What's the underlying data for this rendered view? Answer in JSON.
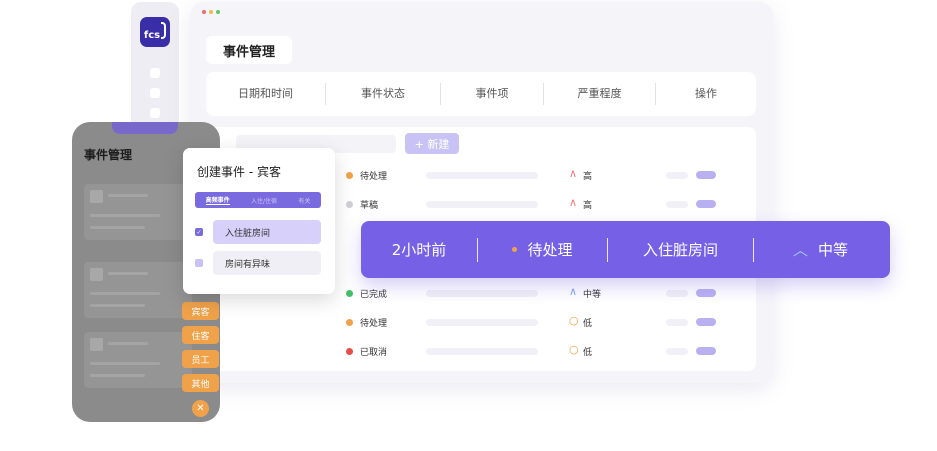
{
  "sidebar": {
    "logo_text": "fcs",
    "dots": 3
  },
  "main": {
    "title": "事件管理",
    "columns": [
      "日期和时间",
      "事件状态",
      "事件项",
      "严重程度",
      "操作"
    ],
    "new_button": "+ 新建",
    "rows": [
      {
        "status": "待处理",
        "status_color": "#f0a24a",
        "severity_icon": "^",
        "severity_icon_color": "#f27a7a",
        "severity": "高"
      },
      {
        "status": "草稿",
        "status_color": "#cfcfd6",
        "severity_icon": "^",
        "severity_icon_color": "#f27a7a",
        "severity": "高"
      },
      {
        "status": "已完成",
        "status_color": "#44c06b",
        "severity_icon": "^",
        "severity_icon_color": "#7aa8f2",
        "severity": "中等"
      },
      {
        "status": "待处理",
        "status_color": "#f0a24a",
        "severity_icon": "O",
        "severity_icon_color": "#f0a24a",
        "severity": "低"
      },
      {
        "status": "已取消",
        "status_color": "#ea4b4b",
        "severity_icon": "O",
        "severity_icon_color": "#f0a24a",
        "severity": "低"
      }
    ]
  },
  "phone": {
    "title": "事件管理",
    "categories": [
      "宾客",
      "住客",
      "员工",
      "其他"
    ],
    "close_icon": "x"
  },
  "modal": {
    "title": "创建事件 - 宾客",
    "tabs": [
      "高频事件",
      "入住/住宿",
      "有关"
    ],
    "items": [
      {
        "label": "入住脏房间",
        "checked": true
      },
      {
        "label": "房间有异味",
        "checked": false
      }
    ]
  },
  "banner": {
    "time": "2小时前",
    "status": "待处理",
    "item": "入住脏房间",
    "severity": "中等"
  },
  "colors": {
    "accent": "#7661e6",
    "orange": "#f0a24a",
    "logo": "#3a2ea8"
  }
}
